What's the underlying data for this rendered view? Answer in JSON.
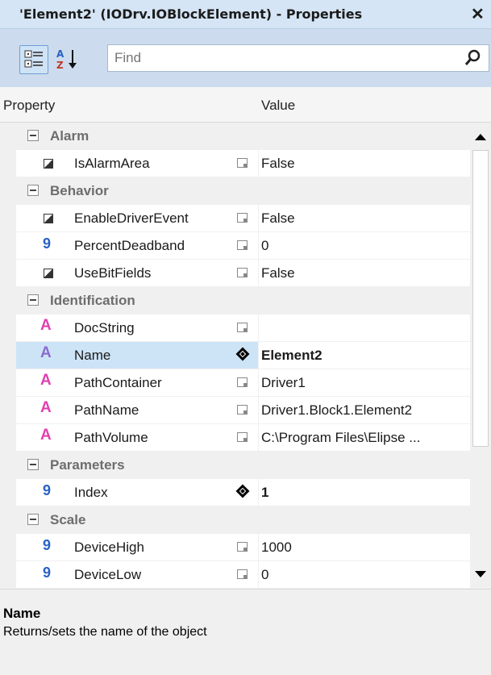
{
  "window": {
    "title": "'Element2' (IODrv.IOBlockElement) - Properties",
    "close": "✕"
  },
  "toolbar": {
    "categorized_icon": "categorized-icon",
    "alphabetical_icon": "sort-alpha-icon",
    "search_placeholder": "Find",
    "search_icon": "search-icon"
  },
  "columns": {
    "property": "Property",
    "value": "Value"
  },
  "categories": [
    {
      "name": "Alarm",
      "props": [
        {
          "name": "IsAlarmArea",
          "value": "False",
          "type": "bool"
        }
      ]
    },
    {
      "name": "Behavior",
      "props": [
        {
          "name": "EnableDriverEvent",
          "value": "False",
          "type": "bool"
        },
        {
          "name": "PercentDeadband",
          "value": "0",
          "type": "num"
        },
        {
          "name": "UseBitFields",
          "value": "False",
          "type": "bool"
        }
      ]
    },
    {
      "name": "Identification",
      "props": [
        {
          "name": "DocString",
          "value": "",
          "type": "str"
        },
        {
          "name": "Name",
          "value": "Element2",
          "type": "str"
        },
        {
          "name": "PathContainer",
          "value": "Driver1",
          "type": "str"
        },
        {
          "name": "PathName",
          "value": "Driver1.Block1.Element2",
          "type": "str"
        },
        {
          "name": "PathVolume",
          "value": "C:\\Program Files\\Elipse ...",
          "type": "str"
        }
      ]
    },
    {
      "name": "Parameters",
      "props": [
        {
          "name": "Index",
          "value": "1",
          "type": "num"
        }
      ]
    },
    {
      "name": "Scale",
      "props": [
        {
          "name": "DeviceHigh",
          "value": "1000",
          "type": "num"
        },
        {
          "name": "DeviceLow",
          "value": "0",
          "type": "num"
        }
      ]
    }
  ],
  "description": {
    "title": "Name",
    "text": "Returns/sets the name of the object"
  },
  "colors": {
    "title_bg": "#d5e5f5",
    "selected_row": "#cde4f7",
    "number_icon": "#2962c5",
    "string_icon": "#e040b0"
  }
}
